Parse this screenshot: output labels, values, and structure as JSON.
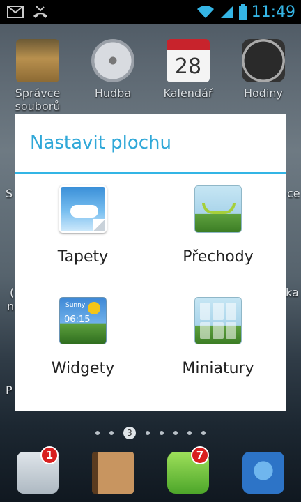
{
  "status_bar": {
    "clock": "11:49",
    "icons": [
      "gmail-icon",
      "missed-call-icon",
      "wifi-icon",
      "signal-icon",
      "battery-icon"
    ]
  },
  "home": {
    "apps": [
      {
        "label": "Správce souborů",
        "icon": "folder-icon"
      },
      {
        "label": "Hudba",
        "icon": "music-disc-icon"
      },
      {
        "label": "Kalendář",
        "icon": "calendar-icon",
        "day": "28"
      },
      {
        "label": "Hodiny",
        "icon": "clock-icon"
      }
    ],
    "side_fragments": {
      "left_1": "S",
      "right_1": "ce",
      "left_2": "(",
      "left_3": "n",
      "right_2": "ka",
      "left_4": "P"
    }
  },
  "dialog": {
    "title": "Nastavit plochu",
    "options": [
      {
        "label": "Tapety",
        "icon": "wallpaper-icon"
      },
      {
        "label": "Přechody",
        "icon": "transitions-icon"
      },
      {
        "label": "Widgety",
        "icon": "widgets-icon",
        "widget_sample": "Sunny",
        "widget_time": "06:15"
      },
      {
        "label": "Miniatury",
        "icon": "thumbnails-icon"
      }
    ]
  },
  "page_indicator": {
    "current": "3"
  },
  "dock": {
    "apps": [
      {
        "icon": "phone-icon",
        "badge": "1"
      },
      {
        "icon": "contacts-icon"
      },
      {
        "icon": "messaging-icon",
        "badge": "7"
      },
      {
        "icon": "browser-globe-icon"
      }
    ]
  },
  "colors": {
    "accent": "#33b5e5",
    "badge": "#d9201f"
  }
}
